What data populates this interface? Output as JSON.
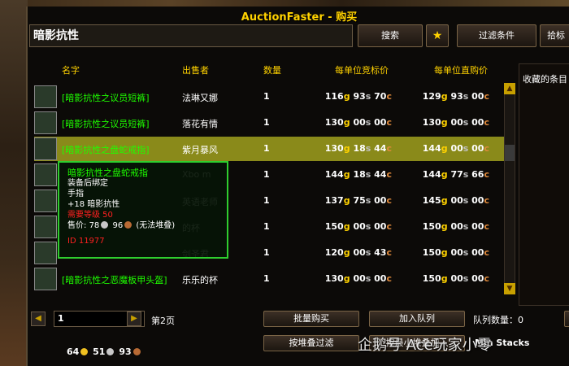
{
  "window": {
    "title": "AuctionFaster - 购买"
  },
  "search": {
    "value": "暗影抗性",
    "search_button": "搜索",
    "favorite_icon": "star-icon",
    "filter_button": "过滤条件",
    "cut_button": "拾标"
  },
  "columns": {
    "name": "名字",
    "seller": "出售者",
    "qty": "数量",
    "bid": "每单位竞标价",
    "buyout": "每单位直购价"
  },
  "favorites_label": "收藏的条目",
  "rows": [
    {
      "name": "[暗影抗性之议员短裤]",
      "seller": "法琳又娜",
      "qty": "1",
      "bid": {
        "g": "116",
        "s": "93",
        "c": "70"
      },
      "buy": {
        "g": "129",
        "s": "93",
        "c": "00"
      },
      "icon": "legs-armor-icon"
    },
    {
      "name": "[暗影抗性之议员短裤]",
      "seller": "落花有情",
      "qty": "1",
      "bid": {
        "g": "130",
        "s": "00",
        "c": "00"
      },
      "buy": {
        "g": "130",
        "s": "00",
        "c": "00"
      },
      "icon": "legs-armor-icon"
    },
    {
      "name": "[暗影抗性之盘蛇戒指]",
      "seller": "紫月暴风",
      "qty": "1",
      "bid": {
        "g": "130",
        "s": "18",
        "c": "44"
      },
      "buy": {
        "g": "144",
        "s": "00",
        "c": "00"
      },
      "icon": "ring-icon"
    },
    {
      "name": "",
      "seller": "Xbo  m",
      "qty": "1",
      "bid": {
        "g": "144",
        "s": "18",
        "c": "44"
      },
      "buy": {
        "g": "144",
        "s": "77",
        "c": "66"
      },
      "icon": "ring-icon"
    },
    {
      "name": "",
      "seller": "英语老师",
      "qty": "1",
      "bid": {
        "g": "137",
        "s": "75",
        "c": "00"
      },
      "buy": {
        "g": "145",
        "s": "00",
        "c": "00"
      },
      "icon": "ring-icon"
    },
    {
      "name": "",
      "seller": "  的杯",
      "qty": "1",
      "bid": {
        "g": "150",
        "s": "00",
        "c": "00"
      },
      "buy": {
        "g": "150",
        "s": "00",
        "c": "00"
      },
      "icon": "bracer-icon"
    },
    {
      "name": "",
      "seller": "剑圣君",
      "qty": "1",
      "bid": {
        "g": "120",
        "s": "00",
        "c": "43"
      },
      "buy": {
        "g": "150",
        "s": "00",
        "c": "00"
      },
      "icon": "ring-gold-icon"
    },
    {
      "name": "[暗影抗性之恶魔板甲头盔]",
      "seller": "乐乐的杯",
      "qty": "1",
      "bid": {
        "g": "130",
        "s": "00",
        "c": "00"
      },
      "buy": {
        "g": "150",
        "s": "00",
        "c": "00"
      },
      "icon": "helm-icon"
    }
  ],
  "tooltip": {
    "name": "暗影抗性之盘蛇戒指",
    "bind": "装备后绑定",
    "slot": "手指",
    "stat": "+18 暗影抗性",
    "req": "需要等级 50",
    "price_label": "售价:",
    "price_s": "78",
    "price_c": "96",
    "note": "(无法堆叠)",
    "id": "ID 11977"
  },
  "pagination": {
    "page_value": "1",
    "page_label": "第2页"
  },
  "bottom": {
    "batch_buy": "批量购买",
    "add_queue": "加入队列",
    "queue_count": "队列数量：0",
    "stack_filter": "按堆叠过滤",
    "add_by_stack": "按最小堆叠加入",
    "min_stacks": "Min Stacks"
  },
  "money": {
    "gold": "64",
    "silver": "51",
    "copper": "93"
  },
  "watermark": "企鹅号 Ace玩家小零"
}
